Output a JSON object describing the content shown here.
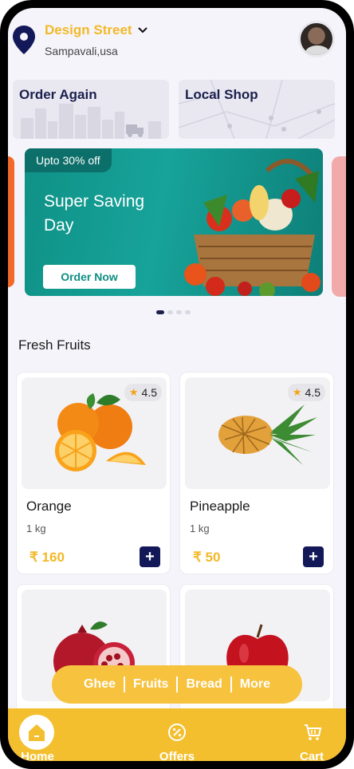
{
  "header": {
    "location_title": "Design Street",
    "location_subtitle": "Sampavali,usa"
  },
  "quick_links": [
    {
      "label": "Order Again"
    },
    {
      "label": "Local Shop"
    }
  ],
  "banner": {
    "tag": "Upto 30% off",
    "headline": "Super Saving Day",
    "button_label": "Order Now"
  },
  "carousel": {
    "pages": 4,
    "active": 1
  },
  "section_title": "Fresh Fruits",
  "products": [
    {
      "name": "Orange",
      "unit": "1 kg",
      "price": "₹ 160",
      "rating": "4.5"
    },
    {
      "name": "Pineapple",
      "unit": "1 kg",
      "price": "₹ 50",
      "rating": "4.5"
    },
    {
      "name": "",
      "unit": "",
      "price": "",
      "rating": ""
    },
    {
      "name": "",
      "unit": "",
      "price": "",
      "rating": ""
    }
  ],
  "category_chips": [
    "Ghee",
    "Fruits",
    "Bread",
    "More"
  ],
  "bottom_nav": [
    {
      "label": "Home",
      "icon": "home-icon"
    },
    {
      "label": "Offers",
      "icon": "offers-icon"
    },
    {
      "label": "Cart",
      "icon": "cart-icon"
    }
  ],
  "colors": {
    "accent": "#f2b928",
    "navy": "#121858",
    "banner": "#0f9186",
    "nav_bg": "#f4bf2e"
  }
}
